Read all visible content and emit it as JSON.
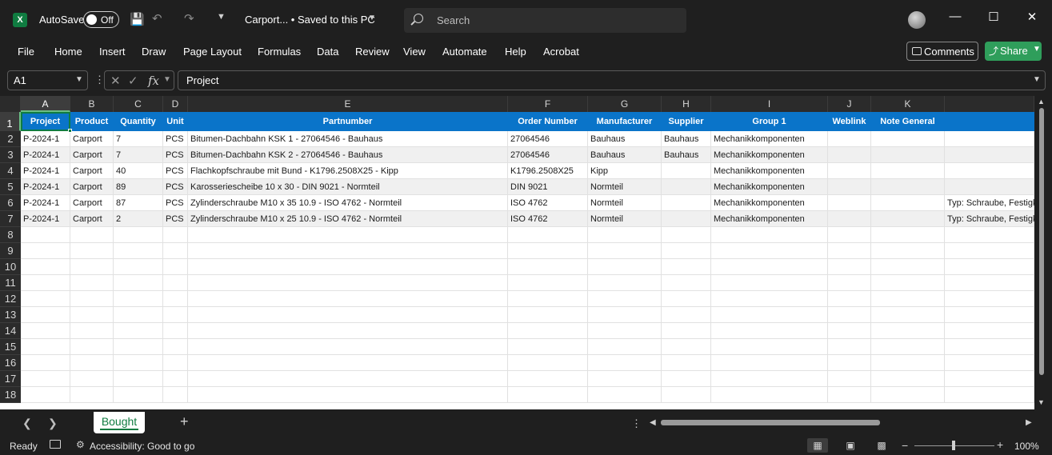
{
  "title_bar": {
    "app_logo": "X",
    "autosave_label": "AutoSave",
    "autosave_state": "Off",
    "doc_title": "Carport...  •  Saved to this PC",
    "search_placeholder": "Search",
    "icons": [
      "save-icon",
      "undo-icon",
      "redo-icon",
      "customize-icon"
    ],
    "minimize": "—",
    "maximize": "☐",
    "close": "✕"
  },
  "ribbon": {
    "tabs": [
      "File",
      "Home",
      "Insert",
      "Draw",
      "Page Layout",
      "Formulas",
      "Data",
      "Review",
      "View",
      "Automate",
      "Help",
      "Acrobat"
    ],
    "comments_label": "Comments",
    "share_label": "Share"
  },
  "formula_bar": {
    "name_box": "A1",
    "fx_label": "fx",
    "formula": "Project"
  },
  "sheet": {
    "columns": [
      "A",
      "B",
      "C",
      "D",
      "E",
      "F",
      "G",
      "H",
      "I",
      "J",
      "K",
      ""
    ],
    "selected_column": "A",
    "row_numbers": [
      "1",
      "2",
      "3",
      "4",
      "5",
      "6",
      "7",
      "8",
      "9",
      "10",
      "11",
      "12",
      "13",
      "14",
      "15",
      "16",
      "17",
      "18"
    ],
    "header_row": [
      "Project",
      "Product",
      "Quantity",
      "Unit",
      "Partnumber",
      "Order Number",
      "Manufacturer",
      "Supplier",
      "Group 1",
      "Weblink",
      "Note General",
      ""
    ],
    "rows": [
      [
        "P-2024-1",
        "Carport",
        "7",
        "PCS",
        "Bitumen-Dachbahn KSK 1 - 27064546 - Bauhaus",
        "27064546",
        "Bauhaus",
        "Bauhaus",
        "Mechanikkomponenten",
        "",
        "",
        ""
      ],
      [
        "P-2024-1",
        "Carport",
        "7",
        "PCS",
        "Bitumen-Dachbahn KSK 2 - 27064546 - Bauhaus",
        "27064546",
        "Bauhaus",
        "Bauhaus",
        "Mechanikkomponenten",
        "",
        "",
        ""
      ],
      [
        "P-2024-1",
        "Carport",
        "40",
        "PCS",
        "Flachkopfschraube mit Bund - K1796.2508X25 - Kipp",
        "K1796.2508X25",
        "Kipp",
        "",
        "Mechanikkomponenten",
        "",
        "",
        ""
      ],
      [
        "P-2024-1",
        "Carport",
        "89",
        "PCS",
        "Karosseriescheibe 10 x 30 - DIN 9021 - Normteil",
        "DIN 9021",
        "Normteil",
        "",
        "Mechanikkomponenten",
        "",
        "",
        ""
      ],
      [
        "P-2024-1",
        "Carport",
        "87",
        "PCS",
        "Zylinderschraube M10 x 35 10.9 - ISO 4762 - Normteil",
        "ISO 4762",
        "Normteil",
        "",
        "Mechanikkomponenten",
        "",
        "",
        "Typ: Schraube, Festigke"
      ],
      [
        "P-2024-1",
        "Carport",
        "2",
        "PCS",
        "Zylinderschraube M10 x 25 10.9 - ISO 4762 - Normteil",
        "ISO 4762",
        "Normteil",
        "",
        "Mechanikkomponenten",
        "",
        "",
        "Typ: Schraube, Festigke"
      ]
    ],
    "empty_row_count": 11
  },
  "sheet_tabs": {
    "tabs": [
      "Bought"
    ],
    "active": "Bought",
    "add_label": "+"
  },
  "status_bar": {
    "ready": "Ready",
    "accessibility": "Accessibility: Good to go",
    "zoom": "100%"
  },
  "colors": {
    "header_fill": "#0a74c9",
    "accent_green": "#107c41",
    "share_green": "#2f9e5b",
    "band_fill": "#f0f0f0"
  }
}
